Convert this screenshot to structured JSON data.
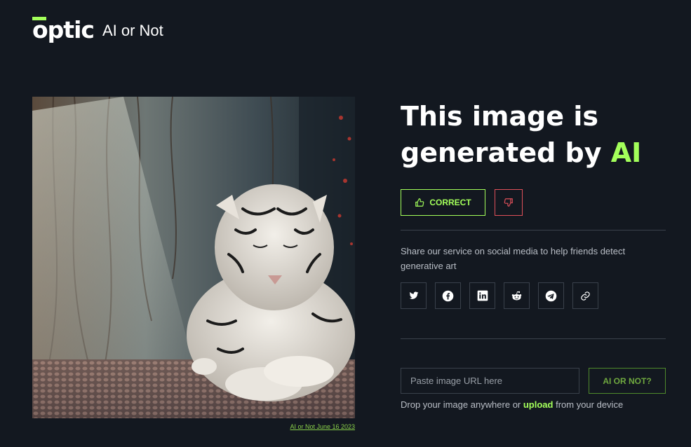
{
  "header": {
    "logo_text": "optic",
    "product_name": "AI or Not"
  },
  "image": {
    "caption": "AI or Not June 16 2023"
  },
  "result": {
    "title_prefix": "This image is generated by ",
    "title_accent": "AI"
  },
  "feedback": {
    "correct_label": "CORRECT"
  },
  "share": {
    "text": "Share our service on social media to help friends detect generative art",
    "icons": [
      "twitter-icon",
      "facebook-icon",
      "linkedin-icon",
      "reddit-icon",
      "telegram-icon",
      "link-icon"
    ]
  },
  "upload": {
    "placeholder": "Paste image URL here",
    "button_label": "AI OR NOT?",
    "drop_prefix": "Drop your image anywhere or ",
    "drop_link": "upload",
    "drop_suffix": " from your device"
  },
  "colors": {
    "background": "#131820",
    "accent": "#a3ff5a",
    "danger": "#e0505a"
  }
}
